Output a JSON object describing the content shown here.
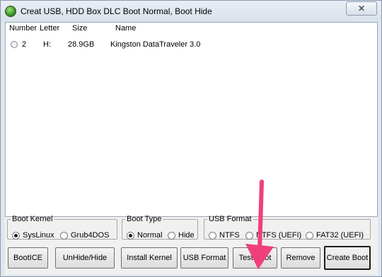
{
  "window": {
    "title": "Creat USB, HDD Box DLC Boot Normal, Boot Hide",
    "close_label": "✕"
  },
  "list": {
    "headers": [
      "Number",
      "Letter",
      "Size",
      "Name"
    ],
    "rows": [
      {
        "number": "2",
        "letter": "H:",
        "size": "28.9GB",
        "name": "Kingston DataTraveler 3.0",
        "selected": false
      }
    ]
  },
  "boot_kernel": {
    "legend": "Boot Kernel",
    "options": [
      {
        "label": "SysLinux",
        "selected": true
      },
      {
        "label": "Grub4DOS",
        "selected": false
      }
    ]
  },
  "boot_type": {
    "legend": "Boot Type",
    "options": [
      {
        "label": "Normal",
        "selected": true
      },
      {
        "label": "Hide",
        "selected": false
      }
    ]
  },
  "usb_format": {
    "legend": "USB Format",
    "options": [
      {
        "label": "NTFS",
        "selected": false
      },
      {
        "label": "NTFS (UEFI)",
        "selected": false
      },
      {
        "label": "FAT32 (UEFI)",
        "selected": false
      }
    ]
  },
  "buttons": {
    "bootice": "BootICE",
    "unhide": "UnHide/Hide",
    "install_kernel": "Install Kernel",
    "usb_format": "USB Format",
    "test_boot": "Test Boot",
    "remove": "Remove",
    "create_boot": "Create Boot"
  },
  "colors": {
    "annotation_arrow": "#f0407a",
    "window_frame": "#dfe6ee"
  },
  "icons": {
    "app": "app-green-orb-icon",
    "close": "close-icon"
  }
}
